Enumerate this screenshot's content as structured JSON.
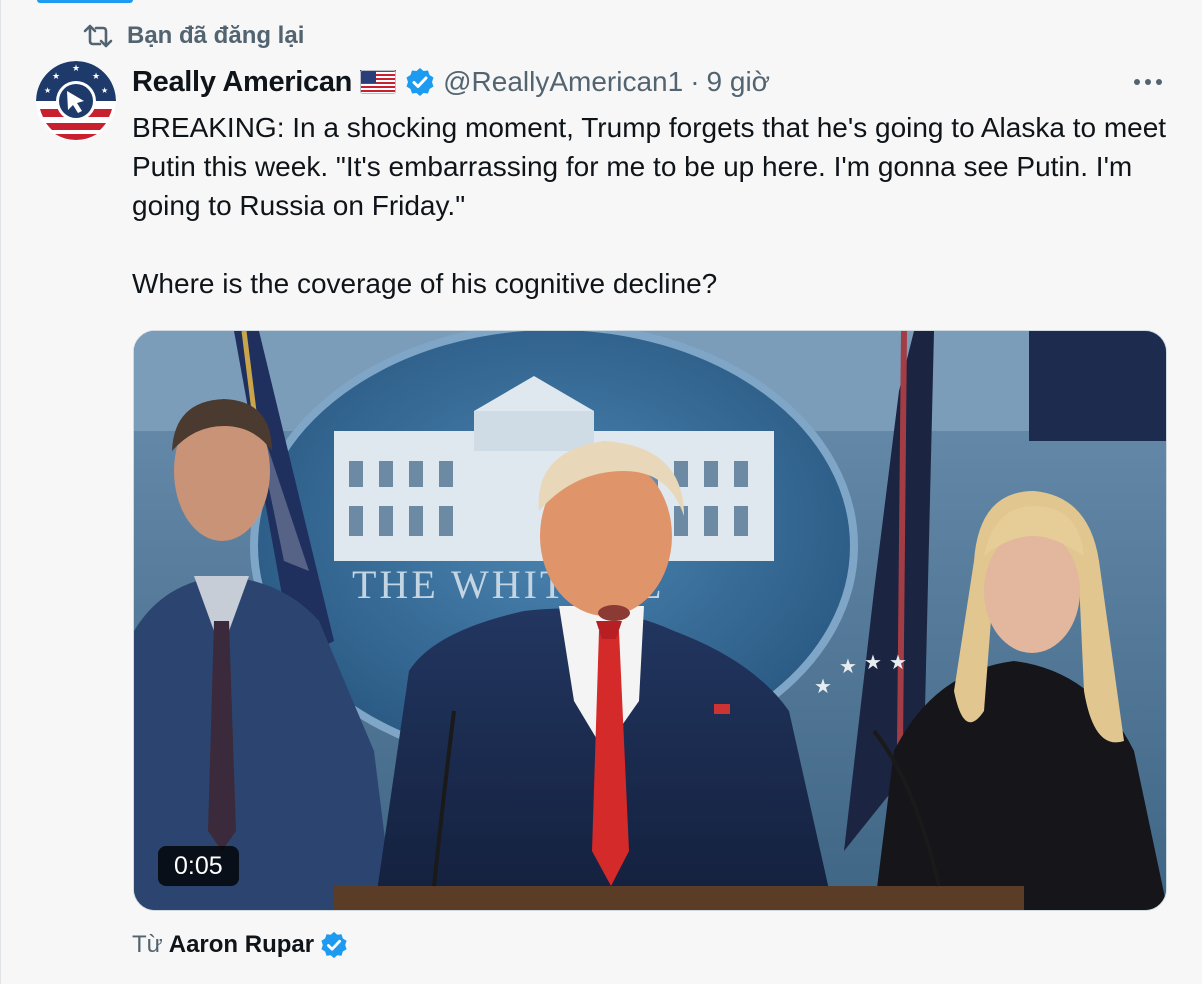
{
  "repost": {
    "label": "Bạn đã đăng lại",
    "icon": "repost-icon"
  },
  "author": {
    "display_name": "Really American",
    "flag_icon": "us-flag-icon",
    "verified_icon": "verified-badge-icon",
    "handle": "@ReallyAmerican1",
    "separator": "·",
    "time": "9 giờ",
    "avatar_icon": "really-american-logo"
  },
  "tweet": {
    "paragraph_1": "BREAKING: In a shocking moment, Trump forgets that he's going to Alaska to meet Putin this week. \"It's embarrassing for me to be up here. I'm gonna see Putin. I'm going to Russia on Friday.\"",
    "paragraph_2": "Where is the coverage of his cognitive decline?"
  },
  "media": {
    "type": "video",
    "duration": "0:05",
    "backdrop_text": "THE WHIT  USE"
  },
  "source": {
    "prefix": "Từ",
    "name": "Aaron Rupar",
    "verified_icon": "verified-badge-icon"
  },
  "colors": {
    "accent_blue": "#1d9bf0",
    "secondary_text": "#536471",
    "primary_text": "#0f1419",
    "tie_red": "#d42a2a",
    "backdrop_blue": "#356b95"
  }
}
